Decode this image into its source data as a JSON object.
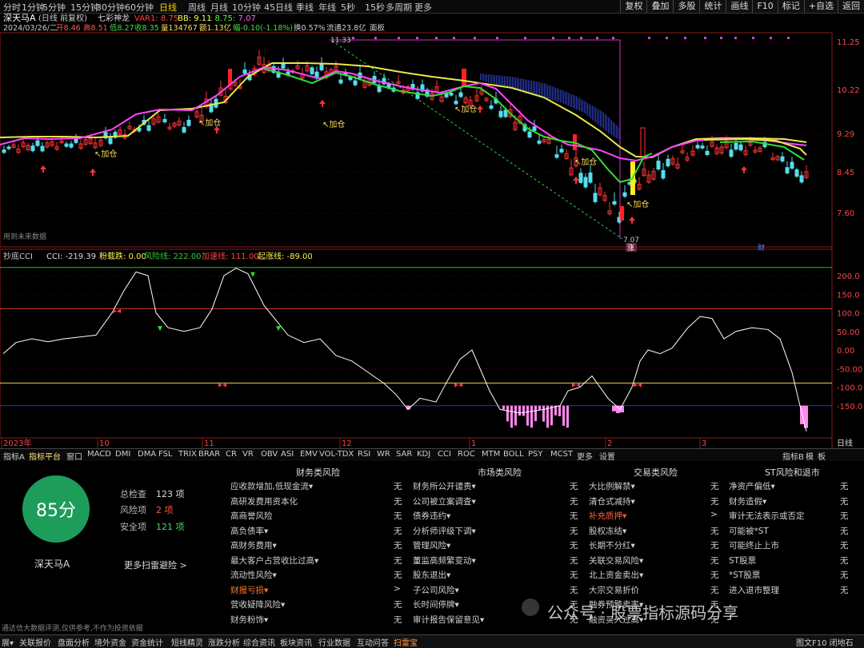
{
  "toolbar": {
    "periods": [
      "分时",
      "1分钟",
      "5分钟",
      "15分钟",
      "30分钟",
      "60分钟",
      "日线",
      "周线",
      "月线",
      "10分钟",
      "45日线",
      "季线",
      "年线",
      "5秒",
      "15秒",
      "多周期",
      "更多"
    ],
    "active_period": "日线",
    "right_buttons": [
      "复权",
      "叠加",
      "多股",
      "统计",
      "画线",
      "F10",
      "标记",
      "+自选",
      "返回"
    ]
  },
  "header": {
    "stock_name": "深天马A",
    "adjust": "(日线 前复权)",
    "indicator_name": "七彩神龙",
    "var1": "VAR1: 8.75",
    "bb": "BB: 9.11",
    "v3": ": 8.75",
    "v4": ": 7.07",
    "info_date": "2024/03/26/二",
    "info_open": "开8.46",
    "info_high": "高8.51",
    "info_low": "低8.27",
    "info_close": "收8.35",
    "info_vol": "量134767",
    "info_amt": "额1.13亿",
    "info_chg": "幅-0.10(-1.18%)",
    "info_turn": "换0.57%",
    "info_float": "流通23.8亿",
    "info_board": "面板"
  },
  "price_axis": [
    "11.25",
    "10.22",
    "9.29",
    "8.45",
    "7.60"
  ],
  "annotations": {
    "high_label": "11.33",
    "low_label": "7.07",
    "add_label": "加仓",
    "future_label": "用到未来数据",
    "tag_zhang": "涨",
    "tag_cai": "财"
  },
  "cci": {
    "title": "抄底CCI",
    "cci_val": "CCI: -219.39",
    "dip_label": "粉载跌: 0.00",
    "risk_label": "风险线: 222.00",
    "add_line": "加速线: 111.00",
    "rise_line": "起涨线: -89.00",
    "axis": [
      "200.0",
      "150.0",
      "100.0",
      "50.00",
      "0.00",
      "-50.00",
      "-100.0",
      "-150.0"
    ],
    "colors": {
      "cci": "#ffffff",
      "risk": "#2eb82e",
      "add": "#e03a3a",
      "rise": "#e6d25a",
      "hist": "#ff88ee"
    }
  },
  "time_axis": [
    "2023年",
    "10",
    "11",
    "12",
    "1",
    "2",
    "3"
  ],
  "time_axis_right": "日线",
  "indicator_tabs": [
    "指标A",
    "指标平台",
    "窗口",
    "MACD",
    "DMI",
    "DMA",
    "FSL",
    "TRIX",
    "BRAR",
    "CR",
    "VR",
    "OBV",
    "ASI",
    "EMV",
    "VOL-TDX",
    "RSI",
    "WR",
    "SAR",
    "KDJ",
    "CCI",
    "ROC",
    "MTM",
    "BOLL",
    "PSY",
    "MCST",
    "更多",
    "设置"
  ],
  "indicator_tabs_right": [
    "指标B",
    "模",
    "板"
  ],
  "risk": {
    "score": "85分",
    "total_label": "总检查",
    "total_val": "123 项",
    "risk_label": "风险项",
    "risk_val": "2 项",
    "safe_label": "安全项",
    "safe_val": "121 项",
    "stock": "深天马A",
    "more": "更多扫雷避险 >",
    "disclaimer": "通达信大数据评测,仅供参考,不作为投资依据",
    "columns": [
      {
        "title": "财务类风险",
        "items": [
          {
            "label": "应收款增加,低现金流▾",
            "val": "无",
            "style": ""
          },
          {
            "label": "高研发费用资本化",
            "val": "无",
            "style": ""
          },
          {
            "label": "高商誉风险",
            "val": "无",
            "style": ""
          },
          {
            "label": "高负债率▾",
            "val": "无",
            "style": ""
          },
          {
            "label": "高财务费用▾",
            "val": "无",
            "style": ""
          },
          {
            "label": "最大客户占营收比过高▾",
            "val": "无",
            "style": ""
          },
          {
            "label": "流动性风险▾",
            "val": "无",
            "style": ""
          },
          {
            "label": "财报亏损▾",
            "val": ">",
            "style": "orange"
          },
          {
            "label": "营收疑降风险▾",
            "val": "无",
            "style": ""
          },
          {
            "label": "财务粉饰▾",
            "val": "无",
            "style": ""
          }
        ]
      },
      {
        "title": "市场类风险",
        "items": [
          {
            "label": "财务所公开谴责▾",
            "val": "无",
            "style": ""
          },
          {
            "label": "公司被立案调查▾",
            "val": "无",
            "style": ""
          },
          {
            "label": "债券违约▾",
            "val": "无",
            "style": ""
          },
          {
            "label": "分析师评级下调▾",
            "val": "无",
            "style": ""
          },
          {
            "label": "管理风险▾",
            "val": "无",
            "style": ""
          },
          {
            "label": "董监高频繁变动▾",
            "val": "无",
            "style": ""
          },
          {
            "label": "股东退出▾",
            "val": "无",
            "style": ""
          },
          {
            "label": "子公司风险▾",
            "val": "无",
            "style": ""
          },
          {
            "label": "长时间停牌▾",
            "val": "无",
            "style": ""
          },
          {
            "label": "审计报告保留意见▾",
            "val": "无",
            "style": ""
          }
        ]
      },
      {
        "title": "交易类风险",
        "items": [
          {
            "label": "大比例解禁▾",
            "val": "无",
            "style": ""
          },
          {
            "label": "清仓式减持▾",
            "val": "无",
            "style": ""
          },
          {
            "label": "补充质押▾",
            "val": ">",
            "style": "red"
          },
          {
            "label": "股权冻结▾",
            "val": "无",
            "style": ""
          },
          {
            "label": "长期不分红▾",
            "val": "无",
            "style": ""
          },
          {
            "label": "关联交易风险▾",
            "val": "无",
            "style": ""
          },
          {
            "label": "北上资金卖出▾",
            "val": "无",
            "style": ""
          },
          {
            "label": "大宗交易折价",
            "val": "无",
            "style": ""
          },
          {
            "label": "融券预警卖率▾",
            "val": "无",
            "style": ""
          },
          {
            "label": "融资买入过高▾",
            "val": "无",
            "style": ""
          }
        ]
      },
      {
        "title": "ST风险和退市",
        "items": [
          {
            "label": "净资产偏低▾",
            "val": "无",
            "style": ""
          },
          {
            "label": "财务造假▾",
            "val": "无",
            "style": ""
          },
          {
            "label": "审计无法表示或否定",
            "val": "无",
            "style": ""
          },
          {
            "label": "可能被*ST",
            "val": "无",
            "style": ""
          },
          {
            "label": "可能终止上市",
            "val": "无",
            "style": ""
          },
          {
            "label": "ST股票",
            "val": "无",
            "style": ""
          },
          {
            "label": "*ST股票",
            "val": "无",
            "style": ""
          },
          {
            "label": "进入退市整理",
            "val": "无",
            "style": ""
          }
        ]
      }
    ]
  },
  "watermark": "公众号 · 股票指标源码分享",
  "bottom_tabs": [
    "展▾",
    "关联报价",
    "盘面分析",
    "境外资金",
    "资金统计",
    "短线精灵",
    "涨跌分析",
    "综合资讯",
    "板块资讯",
    "行业数据",
    "互动问答",
    "扫雷宝"
  ],
  "bottom_active": "扫雷宝",
  "bottom_right": "图文F10  闭地石"
}
